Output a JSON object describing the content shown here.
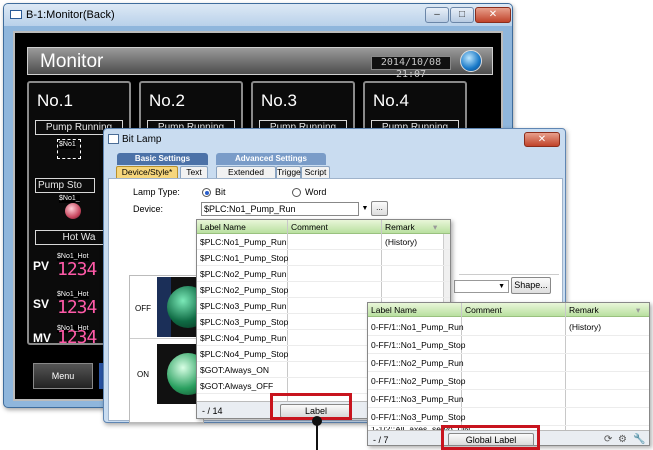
{
  "back_window": {
    "title": "B-1:Monitor(Back)",
    "controls": {
      "minimize": "–",
      "maximize": "□",
      "close": "✕"
    },
    "screen": {
      "title": "Monitor",
      "date_time": "2014/10/08 21:07",
      "panels": [
        {
          "no": "No.1",
          "status": "Pump Running"
        },
        {
          "no": "No.2",
          "status": "Pump Running"
        },
        {
          "no": "No.3",
          "status": "Pump Running"
        },
        {
          "no": "No.4",
          "status": "Pump Running"
        }
      ],
      "panel1": {
        "lamp_tag": "$No1",
        "stop_status": "Pump Sto",
        "stop_tag": "$No1_",
        "hot_water": "Hot Wa",
        "rows": [
          {
            "label": "PV",
            "tag": "$No1_Hot",
            "value": "1234"
          },
          {
            "label": "SV",
            "tag": "$No1_Hot",
            "value": "1234"
          },
          {
            "label": "MV",
            "tag": "$No1_Hot",
            "value": "1234"
          }
        ]
      },
      "menu_button": "Menu"
    }
  },
  "dialog": {
    "title": "Bit Lamp",
    "close": "✕",
    "tab_groups": {
      "basic": "Basic Settings",
      "advanced": "Advanced Settings"
    },
    "tabs": [
      "Device/Style*",
      "Text",
      "Extended",
      "Trigger",
      "Script"
    ],
    "lamp_type_label": "Lamp Type:",
    "lamp_type_options": [
      "Bit",
      "Word"
    ],
    "lamp_type_selected": "Bit",
    "device_label": "Device:",
    "device_value": "$PLC:No1_Pump_Run",
    "browse_button": "...",
    "shape_button": "Shape...",
    "preview_rows": [
      "OFF",
      "ON"
    ]
  },
  "label_dropdown": {
    "columns": [
      "Label Name",
      "Comment",
      "Remark"
    ],
    "rows": [
      {
        "name": "$PLC:No1_Pump_Run",
        "comment": "",
        "remark": "(History)"
      },
      {
        "name": "$PLC:No1_Pump_Stop",
        "comment": "",
        "remark": ""
      },
      {
        "name": "$PLC:No2_Pump_Run",
        "comment": "",
        "remark": ""
      },
      {
        "name": "$PLC:No2_Pump_Stop",
        "comment": "",
        "remark": ""
      },
      {
        "name": "$PLC:No3_Pump_Run",
        "comment": "",
        "remark": ""
      },
      {
        "name": "$PLC:No3_Pump_Stop",
        "comment": "",
        "remark": ""
      },
      {
        "name": "$PLC:No4_Pump_Run",
        "comment": "",
        "remark": ""
      },
      {
        "name": "$PLC:No4_Pump_Stop",
        "comment": "",
        "remark": ""
      },
      {
        "name": "$GOT:Always_ON",
        "comment": "",
        "remark": ""
      },
      {
        "name": "$GOT:Always_OFF",
        "comment": "",
        "remark": ""
      }
    ],
    "count": "- / 14",
    "button": "Label"
  },
  "global_dropdown": {
    "columns": [
      "Label Name",
      "Comment",
      "Remark"
    ],
    "rows": [
      {
        "name": "0-FF/1::No1_Pump_Run",
        "comment": "",
        "remark": "(History)"
      },
      {
        "name": "0-FF/1::No1_Pump_Stop",
        "comment": "",
        "remark": ""
      },
      {
        "name": "0-FF/1::No2_Pump_Run",
        "comment": "",
        "remark": ""
      },
      {
        "name": "0-FF/1::No2_Pump_Stop",
        "comment": "",
        "remark": ""
      },
      {
        "name": "0-FF/1::No3_Pump_Run",
        "comment": "",
        "remark": ""
      },
      {
        "name": "0-FF/1::No3_Pump_Stop",
        "comment": "",
        "remark": ""
      },
      {
        "name": "1-1/2::All_axes_servo_ON",
        "comment": "",
        "remark": ""
      }
    ],
    "count": "- / 7",
    "button": "Global Label",
    "footer_icons": [
      "refresh-icon",
      "settings-icon",
      "wrench-icon"
    ]
  },
  "colors": {
    "highlight": "#c8141e",
    "header_green": "#b9e0a0",
    "active_tab": "#f6d67c",
    "segment_pink": "#ff5aa8"
  }
}
